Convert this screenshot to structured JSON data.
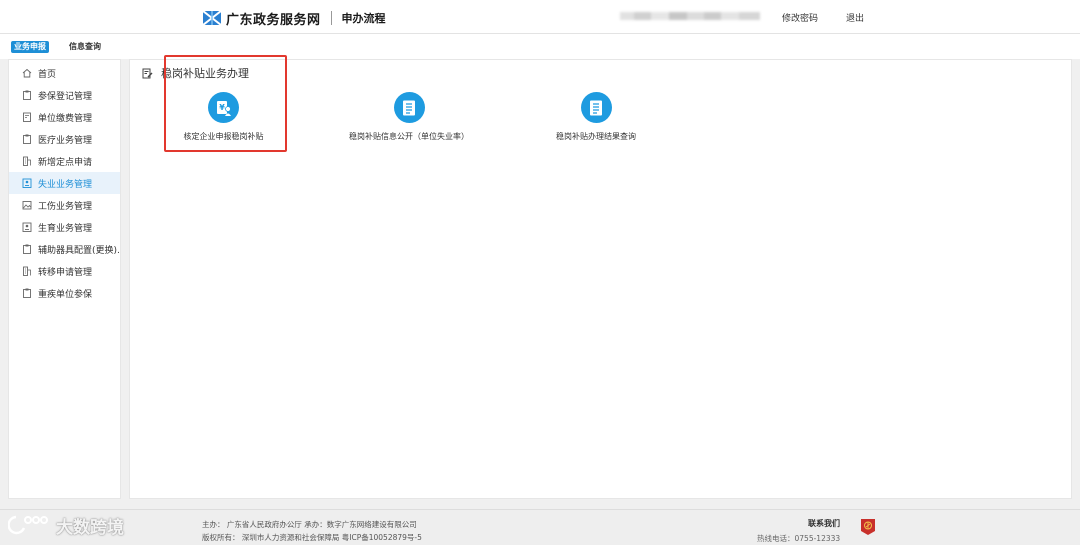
{
  "header": {
    "site_name": "广东政务服务网",
    "section": "申办流程",
    "change_password": "修改密码",
    "logout": "退出"
  },
  "tabs": [
    {
      "label": "业务申报",
      "active": true
    },
    {
      "label": "信息查询",
      "active": false
    }
  ],
  "sidebar": {
    "items": [
      {
        "label": "首页",
        "icon": "home-icon"
      },
      {
        "label": "参保登记管理",
        "icon": "clipboard-icon"
      },
      {
        "label": "单位缴费管理",
        "icon": "document-icon"
      },
      {
        "label": "医疗业务管理",
        "icon": "clipboard-icon"
      },
      {
        "label": "新增定点申请",
        "icon": "building-icon"
      },
      {
        "label": "失业业务管理",
        "icon": "id-card-icon",
        "active": true
      },
      {
        "label": "工伤业务管理",
        "icon": "image-icon"
      },
      {
        "label": "生育业务管理",
        "icon": "id-card-icon"
      },
      {
        "label": "辅助器具配置(更换)..",
        "icon": "clipboard-icon"
      },
      {
        "label": "转移申请管理",
        "icon": "building-icon"
      },
      {
        "label": "重疾单位参保",
        "icon": "clipboard-icon"
      }
    ]
  },
  "main": {
    "title": "稳岗补贴业务办理",
    "functions": [
      {
        "label": "核定企业申报稳岗补贴",
        "icon": "subsidy-icon",
        "highlighted": true
      },
      {
        "label": "稳岗补贴信息公开（单位失业率）",
        "icon": "list-document-icon"
      },
      {
        "label": "稳岗补贴办理结果查询",
        "icon": "list-document-icon"
      }
    ]
  },
  "footer": {
    "line1": "主办： 广东省人民政府办公厅    承办：数字广东网络建设有限公司",
    "line2": "版权所有： 深圳市人力资源和社会保障局   粤ICP备10052879号-5",
    "contact_title": "联系我们",
    "contact_phone": "热线电话：0755-12333"
  },
  "watermark": "大数跨境",
  "colors": {
    "accent": "#1e8fd6",
    "icon_circle": "#1e9be0",
    "highlight": "#e2382e"
  }
}
